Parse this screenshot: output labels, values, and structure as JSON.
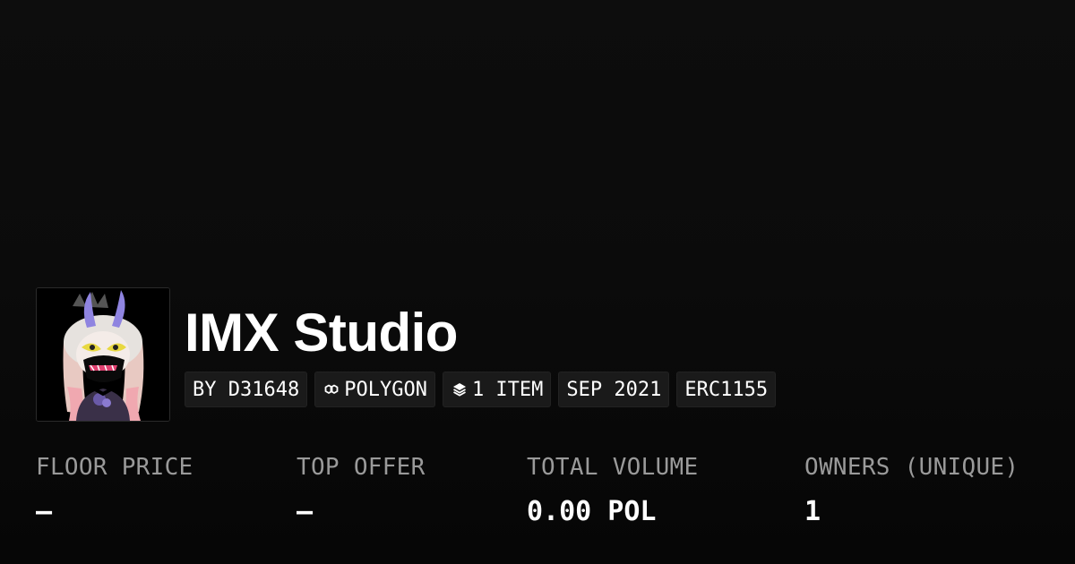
{
  "collection": {
    "title": "IMX Studio",
    "avatar_alt": "collection-avatar"
  },
  "badges": [
    {
      "label": "BY D31648",
      "icon": ""
    },
    {
      "label": "POLYGON",
      "icon": "polygon-icon"
    },
    {
      "label": "1 ITEM",
      "icon": "layers-icon"
    },
    {
      "label": "SEP 2021",
      "icon": ""
    },
    {
      "label": "ERC1155",
      "icon": ""
    }
  ],
  "stats": [
    {
      "label": "FLOOR PRICE",
      "value": "–"
    },
    {
      "label": "TOP OFFER",
      "value": "–"
    },
    {
      "label": "TOTAL VOLUME",
      "value": "0.00 POL"
    },
    {
      "label": "OWNERS (UNIQUE)",
      "value": "1"
    }
  ],
  "colors": {
    "background": "#0b0b0b",
    "badge_background": "#1a1a1a",
    "label_gray": "#9a9a9a",
    "text": "#ffffff"
  }
}
